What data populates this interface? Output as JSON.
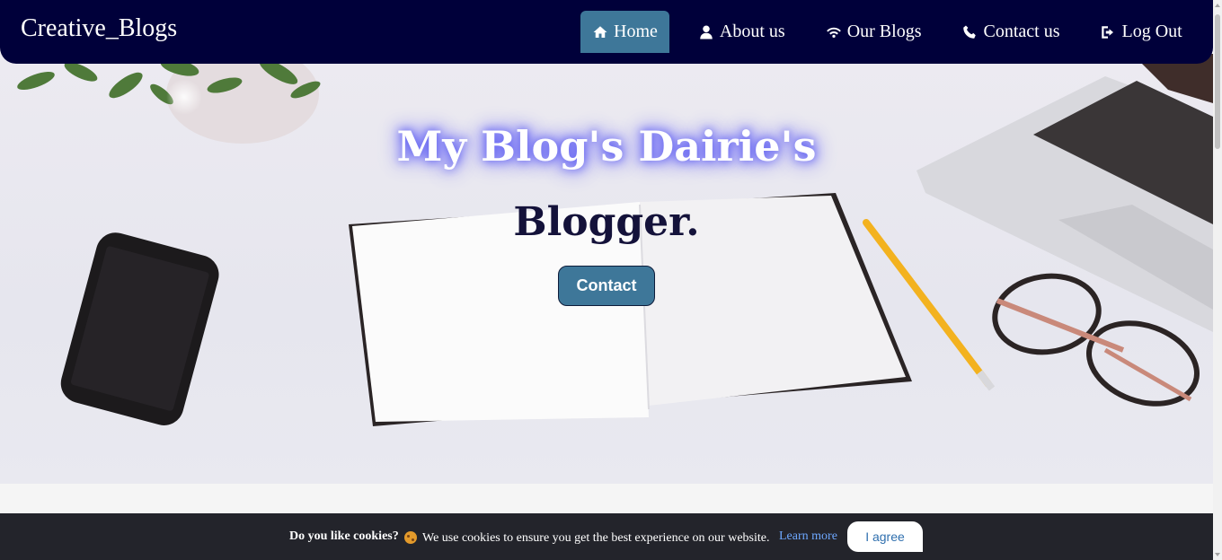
{
  "navbar": {
    "brand": "Creative_Blogs",
    "items": [
      {
        "label": "Home",
        "icon": "home-icon",
        "active": true
      },
      {
        "label": "About us",
        "icon": "user-icon",
        "active": false
      },
      {
        "label": "Our Blogs",
        "icon": "wifi-icon",
        "active": false
      },
      {
        "label": "Contact us",
        "icon": "phone-icon",
        "active": false
      },
      {
        "label": "Log Out",
        "icon": "logout-icon",
        "active": false
      }
    ]
  },
  "hero": {
    "title": "My Blog's Dairie's",
    "subtitle": "Blogger.",
    "button_label": "Contact"
  },
  "cookie": {
    "question": "Do you like cookies?",
    "message": "We use cookies to ensure you get the best experience on our website.",
    "link_label": "Learn more",
    "agree_label": "I agree"
  },
  "colors": {
    "navbar_bg": "#00003a",
    "accent": "#3e7799",
    "cookie_bg": "#23242b",
    "link": "#6ea8ff"
  }
}
